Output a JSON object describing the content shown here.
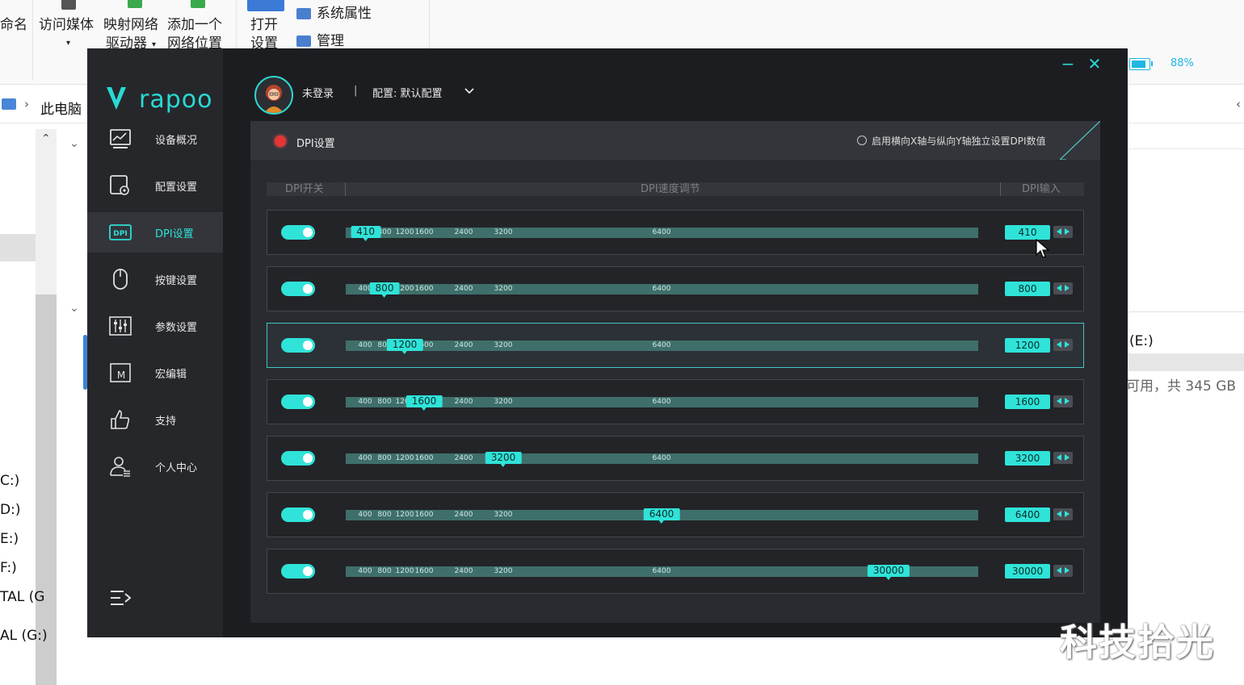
{
  "explorer": {
    "ribbon": {
      "rename": "命名",
      "access_media": "访问媒体",
      "map_drive": [
        "映射网络",
        "驱动器"
      ],
      "add_location": [
        "添加一个",
        "网络位置"
      ],
      "open_settings": [
        "打开",
        "设置"
      ],
      "system_props": "系统属性",
      "manage": "管理"
    },
    "address": {
      "path": "此电脑"
    },
    "tree_items": [
      "C:)",
      "D:)",
      "E:)",
      "F:)",
      "TAL (G",
      "AL (G:)"
    ],
    "right_pane": {
      "drive_label": "(E:)",
      "drive_info": "可用，共 345 GB"
    }
  },
  "watermark": "科技拾光",
  "app": {
    "logo": "rapoo",
    "battery": {
      "percent_text": "88%",
      "level": 0.88,
      "color": "#1fb6e4"
    },
    "window_controls": {
      "minimize": "−",
      "close": "✕"
    },
    "user": {
      "status": "未登录",
      "separator": "|",
      "config_label": "配置: 默认配置"
    },
    "accent": "#2fe3d8",
    "nav": [
      {
        "label": "设备概况",
        "icon": "monitor-chart-icon",
        "active": false
      },
      {
        "label": "配置设置",
        "icon": "config-icon",
        "active": false
      },
      {
        "label": "DPI设置",
        "icon": "dpi-icon",
        "active": true
      },
      {
        "label": "按键设置",
        "icon": "mouse-icon",
        "active": false
      },
      {
        "label": "参数设置",
        "icon": "sliders-icon",
        "active": false
      },
      {
        "label": "宏编辑",
        "icon": "macro-icon",
        "active": false
      },
      {
        "label": "支持",
        "icon": "thumbs-up-icon",
        "active": false
      },
      {
        "label": "个人中心",
        "icon": "user-center-icon",
        "active": false
      }
    ],
    "dpi_panel": {
      "title": "DPI设置",
      "independent_xy_label": "启用横向X轴与纵向Y轴独立设置DPI数值",
      "columns": {
        "switch": "DPI开关",
        "speed": "DPI速度调节",
        "input": "DPI输入"
      },
      "tick_labels": [
        "400",
        "800",
        "1200",
        "1600",
        "2400",
        "3200",
        "6400"
      ],
      "rows": [
        {
          "enabled": true,
          "value": 410,
          "bubble": "410",
          "input": "410",
          "selected": false
        },
        {
          "enabled": true,
          "value": 800,
          "bubble": "800",
          "input": "800",
          "selected": false
        },
        {
          "enabled": true,
          "value": 1200,
          "bubble": "1200",
          "input": "1200",
          "selected": true
        },
        {
          "enabled": true,
          "value": 1600,
          "bubble": "1600",
          "input": "1600",
          "selected": false
        },
        {
          "enabled": true,
          "value": 3200,
          "bubble": "3200",
          "input": "3200",
          "selected": false
        },
        {
          "enabled": true,
          "value": 6400,
          "bubble": "6400",
          "input": "6400",
          "selected": false
        },
        {
          "enabled": true,
          "value": 30000,
          "bubble": "30000",
          "input": "30000",
          "selected": false
        }
      ]
    }
  }
}
